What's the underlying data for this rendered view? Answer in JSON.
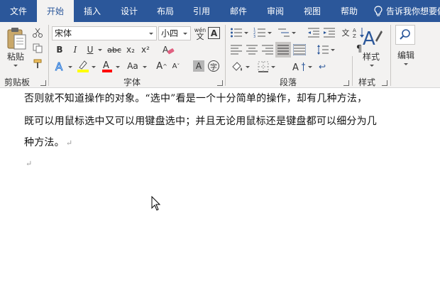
{
  "tabs": [
    {
      "label": "文件",
      "active": false
    },
    {
      "label": "开始",
      "active": true
    },
    {
      "label": "插入",
      "active": false
    },
    {
      "label": "设计",
      "active": false
    },
    {
      "label": "布局",
      "active": false
    },
    {
      "label": "引用",
      "active": false
    },
    {
      "label": "邮件",
      "active": false
    },
    {
      "label": "审阅",
      "active": false
    },
    {
      "label": "视图",
      "active": false
    },
    {
      "label": "帮助",
      "active": false
    }
  ],
  "tell_me": "告诉我你想要做",
  "ribbon": {
    "clipboard": {
      "paste_label": "粘贴",
      "group_label": "剪贴板"
    },
    "font": {
      "font_name": "宋体",
      "font_size": "小四",
      "phonetic_label": "wén",
      "bold": "B",
      "italic": "I",
      "underline": "U",
      "strike": "abc",
      "subscript": "x₂",
      "superscript": "x²",
      "font_case": "Aa",
      "grow": "A",
      "shrink": "A",
      "char_shading": "A",
      "enclose": "字",
      "group_label": "字体"
    },
    "paragraph": {
      "group_label": "段落"
    },
    "styles": {
      "label": "样式",
      "group_label": "样式"
    },
    "editing": {
      "label": "编辑"
    }
  },
  "document": {
    "lines": [
      "否则就不知道操作的对象。“选中”看是一个十分简单的操作，却有几种方法，",
      "既可以用鼠标选中又可以用键盘选中；并且无论用鼠标还是键盘都可以细分为几",
      "种方法。"
    ],
    "paragraph_mark": "↵"
  },
  "colors": {
    "tabbar": "#2b579a",
    "ribbon": "#f3f2f1",
    "highlight": "#ffff00",
    "font_color": "#ff0000",
    "style_accent": "#2b579a"
  }
}
